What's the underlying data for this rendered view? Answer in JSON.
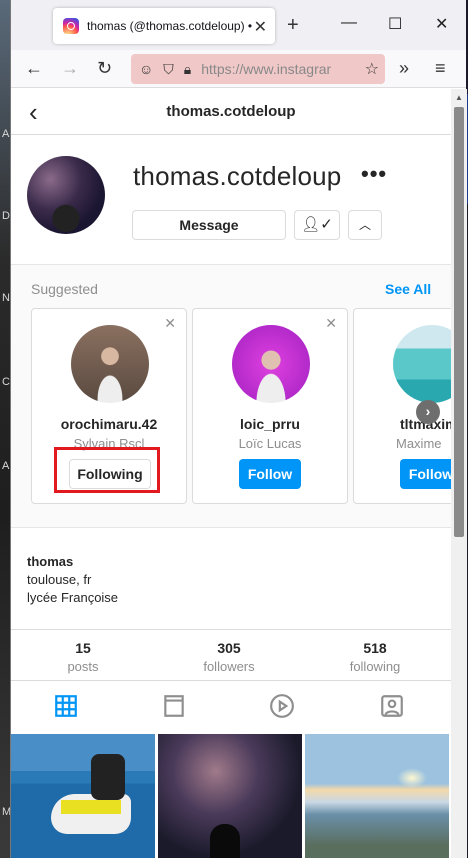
{
  "browser": {
    "tab_title": "thomas (@thomas.cotdeloup) •",
    "url": "https://www.instagram.com/thomas.cotdeloup/"
  },
  "header": {
    "username": "thomas.cotdeloup"
  },
  "profile": {
    "username": "thomas.cotdeloup",
    "message_label": "Message"
  },
  "suggested": {
    "title": "Suggested",
    "see_all": "See All",
    "cards": [
      {
        "username": "orochimaru.42",
        "name": "Sylvain Rscl",
        "button": "Following"
      },
      {
        "username": "loic_prru",
        "name": "Loïc Lucas",
        "button": "Follow"
      },
      {
        "username": "tltmaxim",
        "name": "Maxime",
        "button": "Follow"
      }
    ]
  },
  "bio": {
    "name": "thomas",
    "lines": [
      "toulouse, fr",
      "lycée Françoise"
    ]
  },
  "stats": [
    {
      "value": "15",
      "label": "posts"
    },
    {
      "value": "305",
      "label": "followers"
    },
    {
      "value": "518",
      "label": "following"
    }
  ],
  "colors": {
    "accent": "#0095f6",
    "highlight": "#e2191f"
  }
}
